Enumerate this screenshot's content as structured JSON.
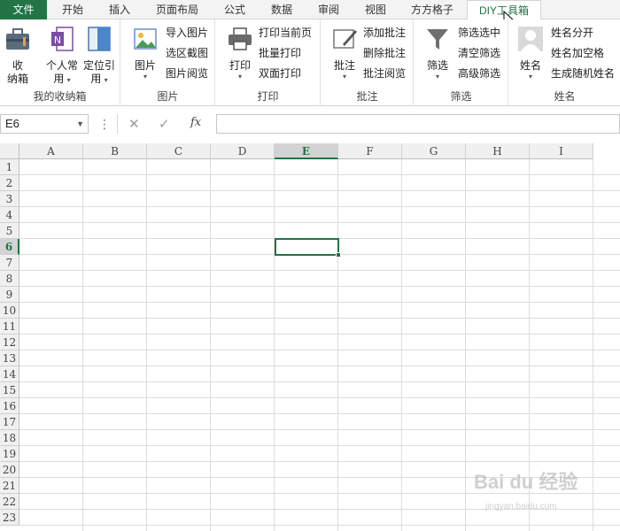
{
  "tabs": [
    {
      "label": "文件"
    },
    {
      "label": "开始"
    },
    {
      "label": "插入"
    },
    {
      "label": "页面布局"
    },
    {
      "label": "公式"
    },
    {
      "label": "数据"
    },
    {
      "label": "审阅"
    },
    {
      "label": "视图"
    },
    {
      "label": "方方格子"
    },
    {
      "label": "DIY工具箱"
    }
  ],
  "active_tab": "DIY工具箱",
  "groups": {
    "collection": {
      "label": "我的收纳箱",
      "btn1": "收\n纳箱",
      "btn1_line1": "收",
      "btn1_line2": "纳箱",
      "btn2_line1": "个人常",
      "btn2_line2": "用",
      "btn3_line1": "定位引",
      "btn3_line2": "用"
    },
    "picture": {
      "label": "图片",
      "big": "图片",
      "items": [
        "导入图片",
        "选区截图",
        "图片阅览"
      ]
    },
    "print": {
      "label": "打印",
      "big": "打印",
      "items": [
        "打印当前页",
        "批量打印",
        "双面打印"
      ]
    },
    "comment": {
      "label": "批注",
      "big": "批注",
      "items": [
        "添加批注",
        "删除批注",
        "批注阅览"
      ]
    },
    "filter": {
      "label": "筛选",
      "big": "筛选",
      "items": [
        "筛选选中",
        "清空筛选",
        "高级筛选"
      ]
    },
    "name": {
      "label": "姓名",
      "big": "姓名",
      "items": [
        "姓名分开",
        "姓名加空格",
        "生成随机姓名"
      ]
    }
  },
  "formula_bar": {
    "name_box": "E6",
    "fx": "fx",
    "value": ""
  },
  "columns": [
    "A",
    "B",
    "C",
    "D",
    "E",
    "F",
    "G",
    "H",
    "I"
  ],
  "rows": [
    "1",
    "2",
    "3",
    "4",
    "5",
    "6",
    "7",
    "8",
    "9",
    "10",
    "11",
    "12",
    "13",
    "14",
    "15",
    "16",
    "17",
    "18",
    "19",
    "20",
    "21",
    "22",
    "23"
  ],
  "active_cell": "E6",
  "watermark": {
    "text": "Bai du 经验",
    "url": "jingyan.baidu.com"
  },
  "colors": {
    "accent": "#217346",
    "file_tab": "#227447"
  }
}
